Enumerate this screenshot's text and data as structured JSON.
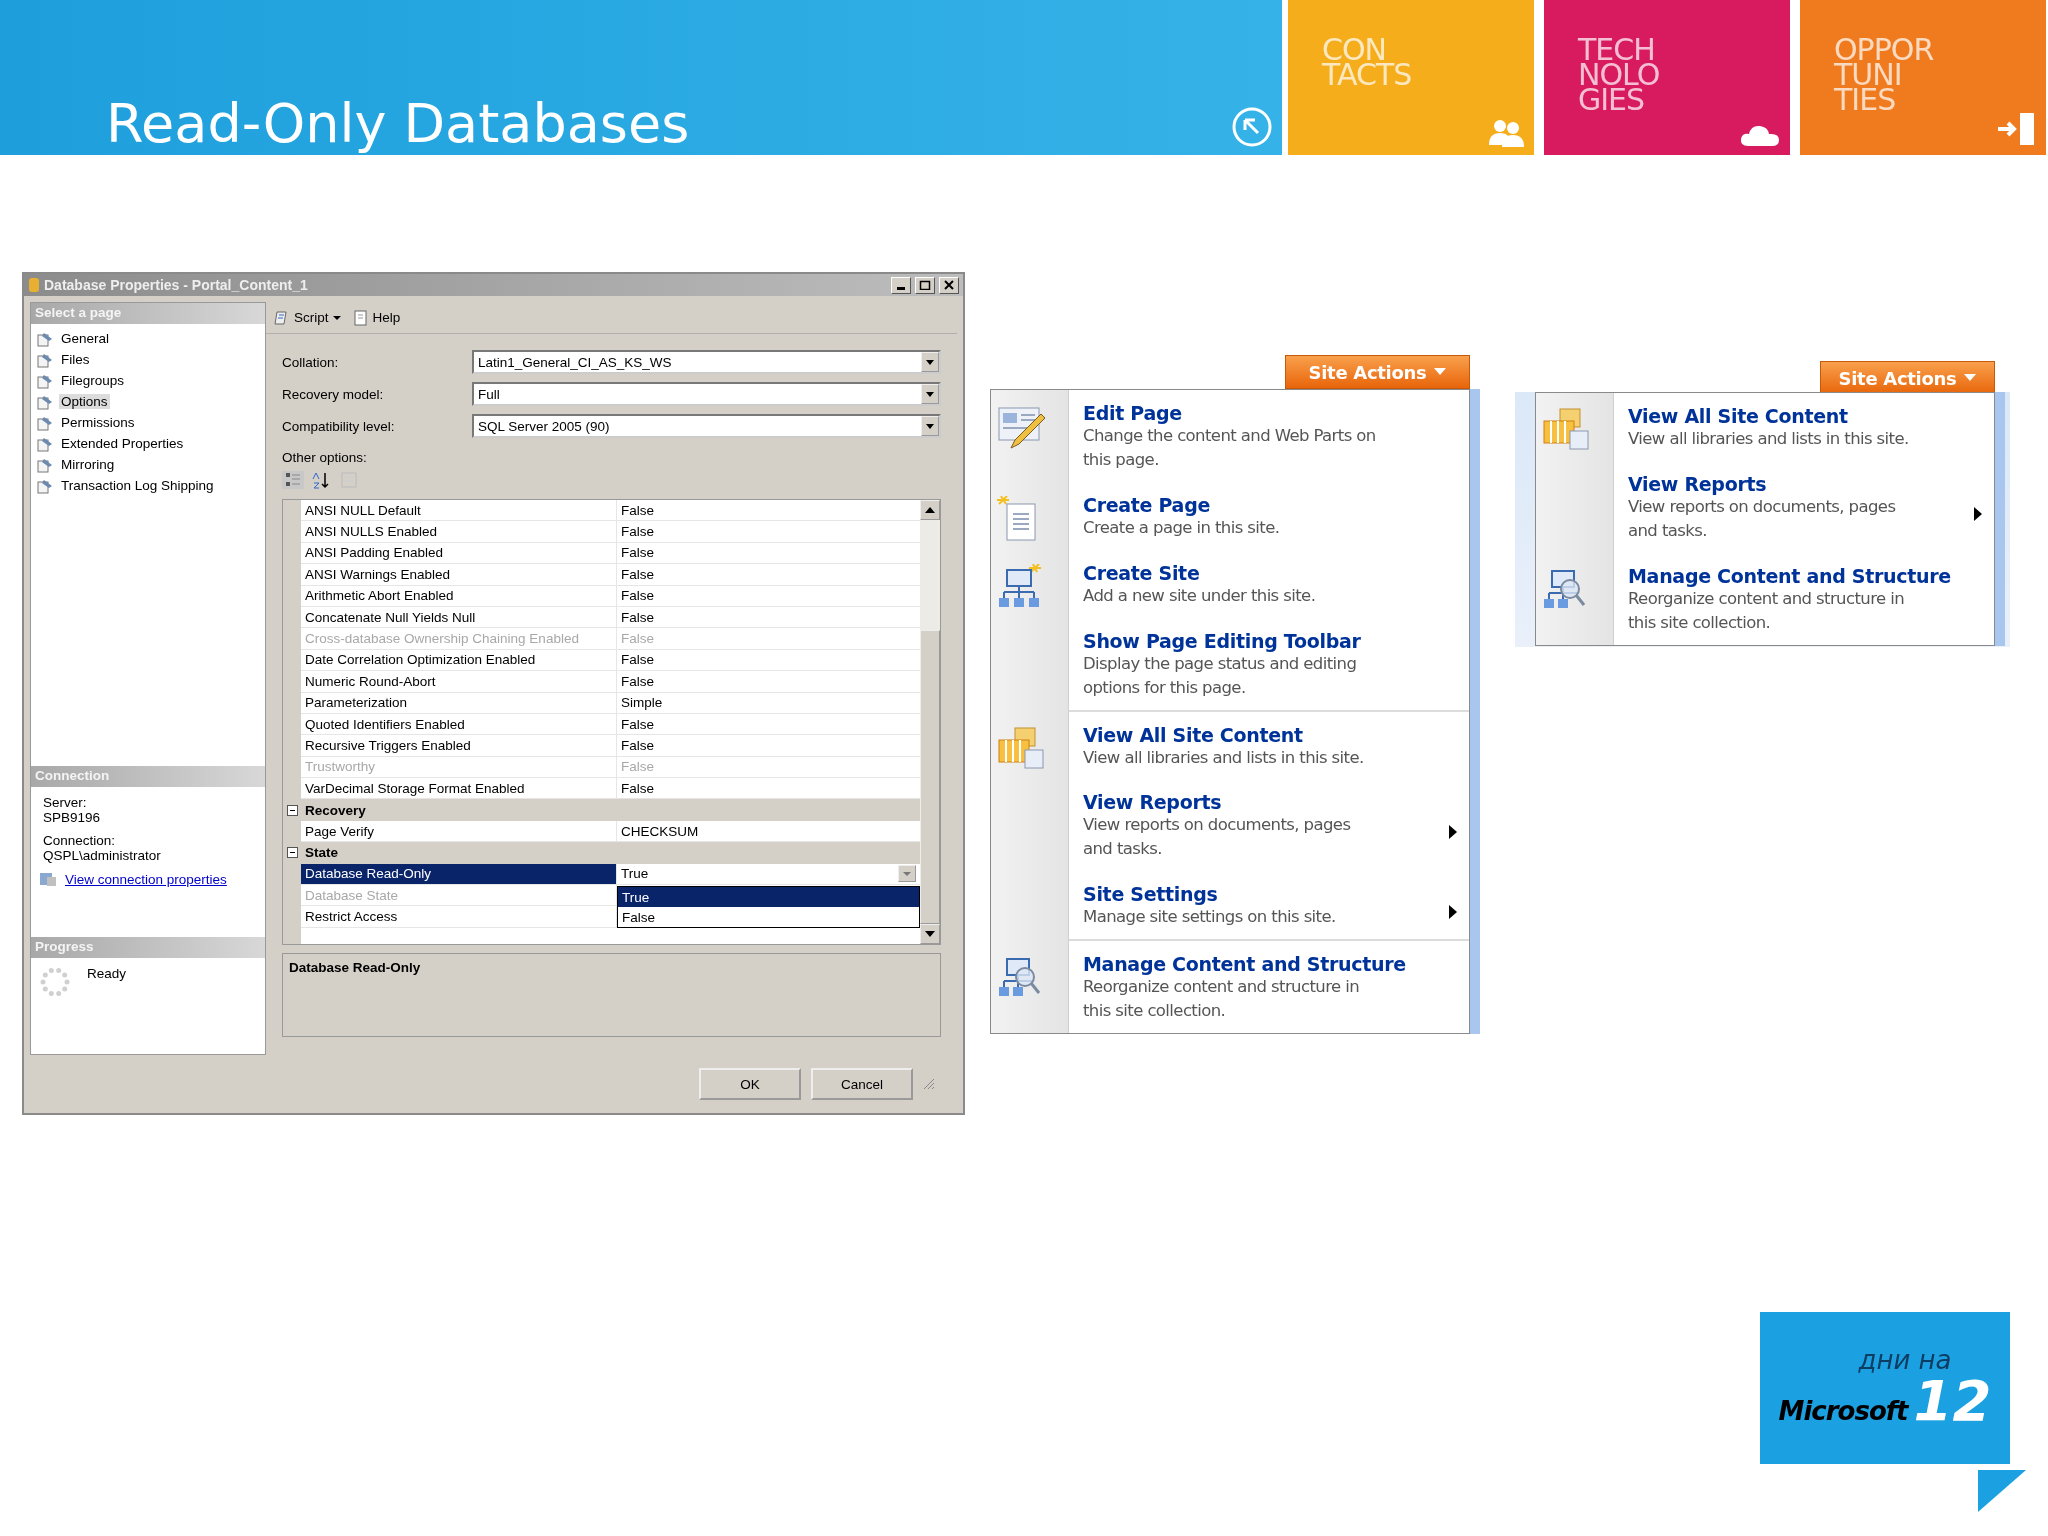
{
  "slide": {
    "title": "Read-Only Databases"
  },
  "tiles": [
    {
      "lines": [
        "CON",
        "TACTS"
      ],
      "color": "#f5ad1c",
      "kind": "people"
    },
    {
      "lines": [
        "TECH",
        "NOLO",
        "GIES"
      ],
      "color": "#d81b5e",
      "kind": "cloud"
    },
    {
      "lines": [
        "OPPOR",
        "TUNI",
        "TIES"
      ],
      "color": "#f07a1e",
      "kind": "exit"
    }
  ],
  "dialog": {
    "title": "Database Properties - Portal_Content_1",
    "select_page_header": "Select a page",
    "pages": [
      {
        "label": "General",
        "selected": false
      },
      {
        "label": "Files",
        "selected": false
      },
      {
        "label": "Filegroups",
        "selected": false
      },
      {
        "label": "Options",
        "selected": true
      },
      {
        "label": "Permissions",
        "selected": false
      },
      {
        "label": "Extended Properties",
        "selected": false
      },
      {
        "label": "Mirroring",
        "selected": false
      },
      {
        "label": "Transaction Log Shipping",
        "selected": false
      }
    ],
    "connection_header": "Connection",
    "server_label": "Server:",
    "server": "SPB9196",
    "connection_label": "Connection:",
    "connection": "QSPL\\administrator",
    "connection_link": "View connection properties",
    "progress_header": "Progress",
    "progress_status": "Ready",
    "toolbar": [
      {
        "label": "Script",
        "kind": "script"
      },
      {
        "label": "Help",
        "kind": "help"
      }
    ],
    "fields": [
      {
        "label": "Collation:",
        "value": "Latin1_General_CI_AS_KS_WS"
      },
      {
        "label": "Recovery model:",
        "value": "Full"
      },
      {
        "label": "Compatibility level:",
        "value": "SQL Server 2005 (90)"
      }
    ],
    "other_options_label": "Other options:",
    "grid": [
      {
        "kind": "row",
        "name": "ANSI NULL Default",
        "value": "False",
        "disabled": false,
        "selected": false
      },
      {
        "kind": "row",
        "name": "ANSI NULLS Enabled",
        "value": "False",
        "disabled": false,
        "selected": false
      },
      {
        "kind": "row",
        "name": "ANSI Padding Enabled",
        "value": "False",
        "disabled": false,
        "selected": false
      },
      {
        "kind": "row",
        "name": "ANSI Warnings Enabled",
        "value": "False",
        "disabled": false,
        "selected": false
      },
      {
        "kind": "row",
        "name": "Arithmetic Abort Enabled",
        "value": "False",
        "disabled": false,
        "selected": false
      },
      {
        "kind": "row",
        "name": "Concatenate Null Yields Null",
        "value": "False",
        "disabled": false,
        "selected": false
      },
      {
        "kind": "row",
        "name": "Cross-database Ownership Chaining Enabled",
        "value": "False",
        "disabled": true,
        "selected": false
      },
      {
        "kind": "row",
        "name": "Date Correlation Optimization Enabled",
        "value": "False",
        "disabled": false,
        "selected": false
      },
      {
        "kind": "row",
        "name": "Numeric Round-Abort",
        "value": "False",
        "disabled": false,
        "selected": false
      },
      {
        "kind": "row",
        "name": "Parameterization",
        "value": "Simple",
        "disabled": false,
        "selected": false
      },
      {
        "kind": "row",
        "name": "Quoted Identifiers Enabled",
        "value": "False",
        "disabled": false,
        "selected": false
      },
      {
        "kind": "row",
        "name": "Recursive Triggers Enabled",
        "value": "False",
        "disabled": false,
        "selected": false
      },
      {
        "kind": "row",
        "name": "Trustworthy",
        "value": "False",
        "disabled": true,
        "selected": false
      },
      {
        "kind": "row",
        "name": "VarDecimal Storage Format Enabled",
        "value": "False",
        "disabled": false,
        "selected": false
      },
      {
        "kind": "category",
        "name": "Recovery",
        "expanded": true
      },
      {
        "kind": "row",
        "name": "Page Verify",
        "value": "CHECKSUM",
        "disabled": false,
        "selected": false
      },
      {
        "kind": "category",
        "name": "State",
        "expanded": true
      },
      {
        "kind": "row",
        "name": "Database Read-Only",
        "value": "True",
        "disabled": false,
        "selected": true
      },
      {
        "kind": "row",
        "name": "Database State",
        "disabled": true,
        "selected": false
      },
      {
        "kind": "row",
        "name": "Restrict Access",
        "disabled": false,
        "selected": false
      }
    ],
    "dropdown_options": [
      {
        "label": "True",
        "selected": true
      },
      {
        "label": "False",
        "selected": false
      }
    ],
    "description": "Database Read-Only",
    "buttons": [
      "OK",
      "Cancel"
    ]
  },
  "menus": [
    {
      "button": "Site Actions",
      "items": [
        {
          "title": "Edit Page",
          "description": "Change the content and Web Parts on this page.",
          "kind": "edit-page",
          "submenu": false,
          "separator_before": false
        },
        {
          "title": "Create Page",
          "description": "Create a page in this site.",
          "kind": "create-page",
          "submenu": false,
          "separator_before": false
        },
        {
          "title": "Create Site",
          "description": "Add a new site under this site.",
          "kind": "create-site",
          "submenu": false,
          "separator_before": false
        },
        {
          "title": "Show Page Editing Toolbar",
          "description": "Display the page status and editing options for this page.",
          "kind": "plain",
          "submenu": false,
          "separator_before": false
        },
        {
          "title": "View All Site Content",
          "description": "View all libraries and lists in this site.",
          "kind": "content",
          "submenu": false,
          "separator_before": true
        },
        {
          "title": "View Reports",
          "description": "View reports on documents, pages and tasks.",
          "kind": "plain",
          "submenu": true,
          "separator_before": false
        },
        {
          "title": "Site Settings",
          "description": "Manage site settings on this site.",
          "kind": "plain",
          "submenu": true,
          "separator_before": false
        },
        {
          "title": "Manage Content and Structure",
          "description": "Reorganize content and structure in this site collection.",
          "kind": "manage",
          "submenu": false,
          "separator_before": true
        }
      ]
    },
    {
      "button": "Site Actions",
      "items": [
        {
          "title": "View All Site Content",
          "description": "View all libraries and lists in this site.",
          "kind": "content",
          "submenu": false,
          "separator_before": false
        },
        {
          "title": "View Reports",
          "description": "View reports on documents, pages and tasks.",
          "kind": "plain",
          "submenu": true,
          "separator_before": false
        },
        {
          "title": "Manage Content and Structure",
          "description": "Reorganize content and structure in this site collection.",
          "kind": "manage",
          "submenu": false,
          "separator_before": false
        }
      ]
    }
  ],
  "logo": {
    "top": "дни на",
    "brand": "Microsoft",
    "number": "12"
  }
}
